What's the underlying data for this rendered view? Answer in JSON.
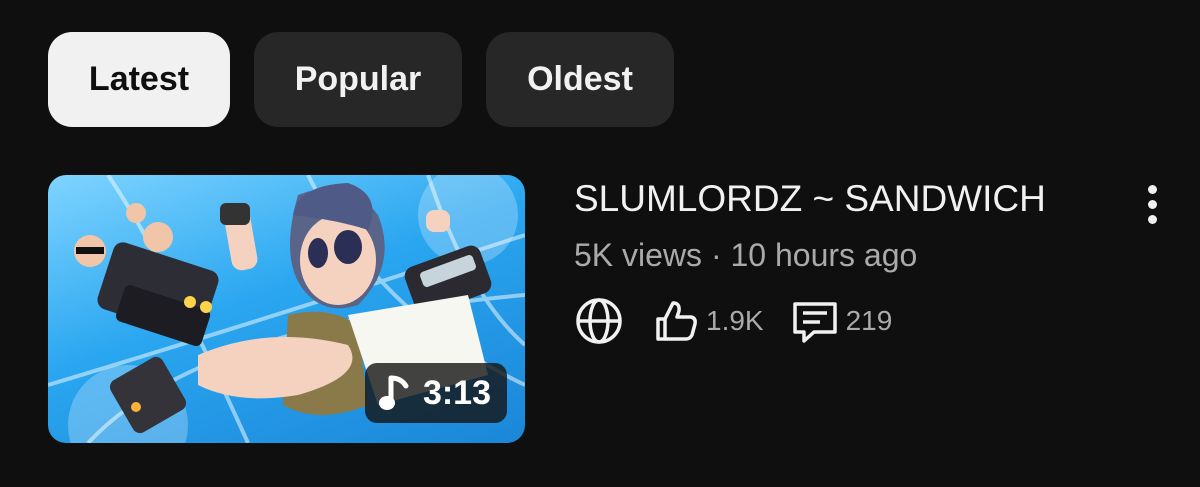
{
  "filters": {
    "chips": [
      {
        "label": "Latest",
        "active": true
      },
      {
        "label": "Popular",
        "active": false
      },
      {
        "label": "Oldest",
        "active": false
      }
    ]
  },
  "video": {
    "title": "SLUMLORDZ ~ SANDWICH",
    "views": "5K views",
    "separator": "·",
    "age": "10 hours ago",
    "subline": "5K views · 10 hours ago",
    "duration": "3:13",
    "duration_icon": "music-note-icon",
    "visibility_icon": "globe-icon",
    "likes": "1.9K",
    "likes_icon": "thumbs-up-icon",
    "comments": "219",
    "comments_icon": "comment-icon",
    "menu_icon": "more-vertical-icon"
  },
  "colors": {
    "background": "#0f0f0f",
    "chip_active_bg": "#f1f1f1",
    "chip_inactive_bg": "#272727",
    "primary_text": "#f1f1f1",
    "secondary_text": "#aaaaaa",
    "thumbnail_sky": "#2aa6f0"
  }
}
